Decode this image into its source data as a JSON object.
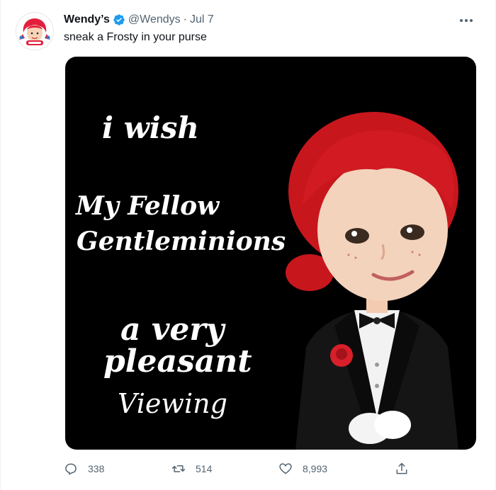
{
  "tweet": {
    "display_name": "Wendy’s",
    "handle": "@Wendys",
    "separator": "·",
    "timestamp": "Jul 7",
    "text": "sneak a Frosty in your purse"
  },
  "media": {
    "line1": "i wish",
    "line2": "My Fellow",
    "line3": "Gentleminions",
    "line4": "a very",
    "line5": "pleasant",
    "line6": "Viewing"
  },
  "actions": {
    "replies": "338",
    "retweets": "514",
    "likes": "8,993"
  },
  "icons": {
    "verified": "verified-badge-icon",
    "more": "more-dots-icon",
    "reply": "reply-icon",
    "retweet": "retweet-icon",
    "like": "heart-icon",
    "share": "share-icon"
  },
  "colors": {
    "verified_blue": "#1d9bf0",
    "secondary_text": "#536471",
    "wendys_red": "#e2203d"
  }
}
